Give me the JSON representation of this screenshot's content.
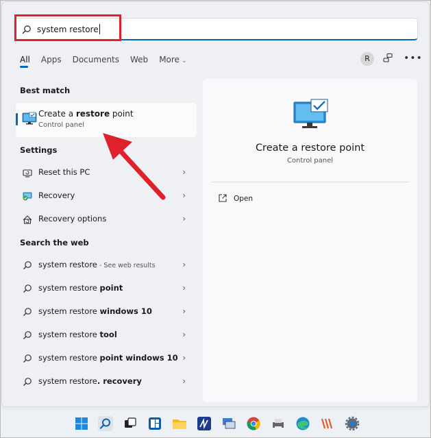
{
  "search": {
    "query": "system restore"
  },
  "tabs": [
    {
      "label": "All"
    },
    {
      "label": "Apps"
    },
    {
      "label": "Documents"
    },
    {
      "label": "Web"
    },
    {
      "label": "More"
    }
  ],
  "account": {
    "avatar_letter": "R"
  },
  "sections": {
    "best_match": "Best match",
    "settings": "Settings",
    "search_web": "Search the web"
  },
  "best_match": {
    "title_pre": "Create a ",
    "title_bold": "restore",
    "title_post": " point",
    "subtitle": "Control panel"
  },
  "settings_items": [
    {
      "label": "Reset this PC"
    },
    {
      "label": "Recovery"
    },
    {
      "label": "Recovery options"
    }
  ],
  "web_items": [
    {
      "normal": "system restore",
      "bold": "",
      "hint": " - See web results"
    },
    {
      "normal": "system restore ",
      "bold": "point",
      "hint": ""
    },
    {
      "normal": "system restore ",
      "bold": "windows 10",
      "hint": ""
    },
    {
      "normal": "system restore ",
      "bold": "tool",
      "hint": ""
    },
    {
      "normal": "system restore ",
      "bold": "point windows 10",
      "hint": ""
    },
    {
      "normal": "system restore",
      "bold": ". recovery",
      "hint": ""
    }
  ],
  "preview": {
    "title": "Create a restore point",
    "subtitle": "Control panel",
    "open_label": "Open"
  },
  "colors": {
    "accent": "#0067c0",
    "annotation_red": "#e0202a"
  }
}
